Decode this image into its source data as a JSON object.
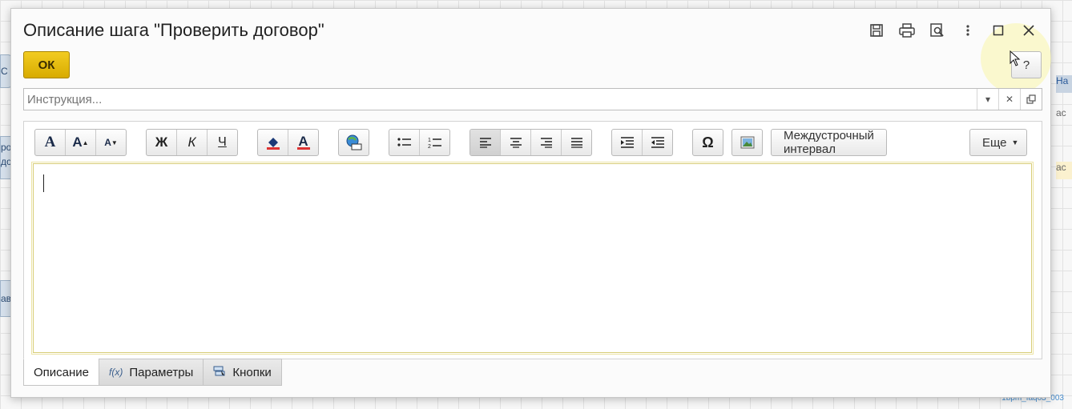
{
  "dialog": {
    "title": "Описание шага \"Проверить договор\"",
    "ok_label": "ОК",
    "help_label": "?"
  },
  "title_icons": [
    "save-icon",
    "print-icon",
    "preview-icon",
    "more-icon",
    "maximize-icon",
    "close-icon"
  ],
  "instruction": {
    "placeholder": "Инструкция...",
    "value": ""
  },
  "toolbar": {
    "bold_label": "Ж",
    "italic_label": "К",
    "underline_label": "Ч",
    "font_label": "A",
    "grow_label": "A",
    "shrink_label": "A",
    "color_label": "A",
    "special_char_label": "Ω",
    "line_spacing_label": "Междустрочный интервал",
    "more_label": "Еще"
  },
  "editor": {
    "content": ""
  },
  "tabs": [
    {
      "label": "Описание",
      "active": true
    },
    {
      "label": "Параметры",
      "icon": "f(x)"
    },
    {
      "label": "Кнопки"
    }
  ],
  "background": {
    "right_labels": [
      "На",
      "ас",
      "ас"
    ],
    "left_labels": [
      "С",
      "ро\nдо",
      "ав"
    ]
  },
  "watermark": "1bpm_faq03_003",
  "colors": {
    "ok_button": "#e6b900",
    "active_border": "#d8cd78"
  }
}
